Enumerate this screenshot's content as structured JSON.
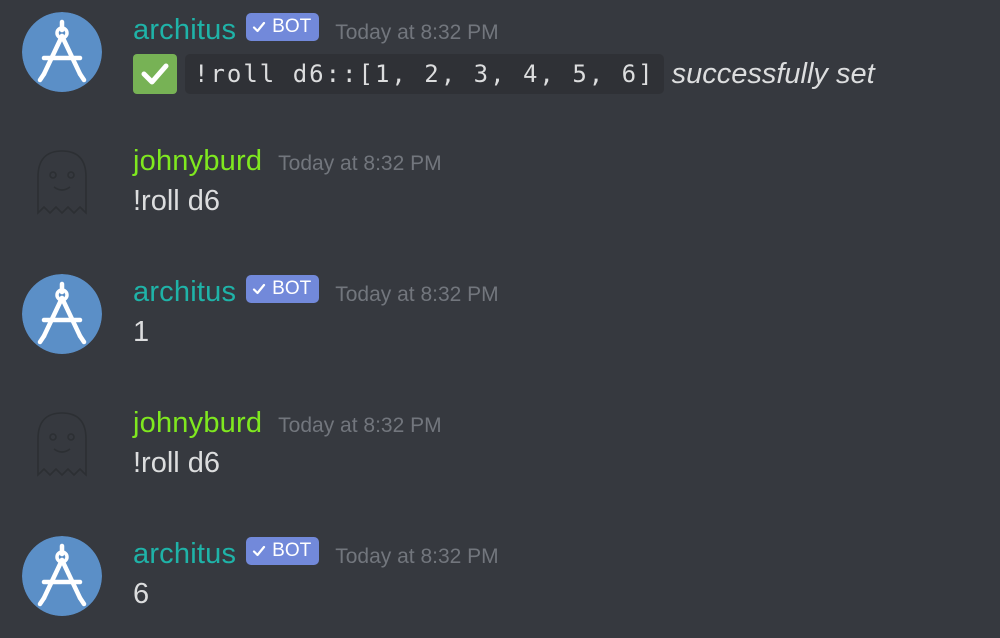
{
  "messages": [
    {
      "author": "architus",
      "bot_tag": "BOT",
      "timestamp": "Today at 8:32 PM",
      "content": {
        "code": "!roll d6::[1, 2, 3, 4, 5, 6]",
        "suffix": "successfully set"
      }
    },
    {
      "author": "johnyburd",
      "timestamp": "Today at 8:32 PM",
      "content": {
        "text": "!roll d6"
      }
    },
    {
      "author": "architus",
      "bot_tag": "BOT",
      "timestamp": "Today at 8:32 PM",
      "content": {
        "text": "1"
      }
    },
    {
      "author": "johnyburd",
      "timestamp": "Today at 8:32 PM",
      "content": {
        "text": "!roll d6"
      }
    },
    {
      "author": "architus",
      "bot_tag": "BOT",
      "timestamp": "Today at 8:32 PM",
      "content": {
        "text": "6"
      }
    }
  ],
  "colors": {
    "background": "#36393f",
    "bot_username": "#1fb3a8",
    "user_username": "#7fe81f",
    "bot_tag": "#7289da",
    "timestamp": "#72767d",
    "bot_avatar": "#5b8fc7",
    "check_emoji": "#77b255"
  },
  "icons": {
    "bot_avatar": "compass-icon",
    "user_avatar": "ghost-icon",
    "bot_tag_check": "check-icon",
    "content_check": "white-check-mark-icon"
  }
}
